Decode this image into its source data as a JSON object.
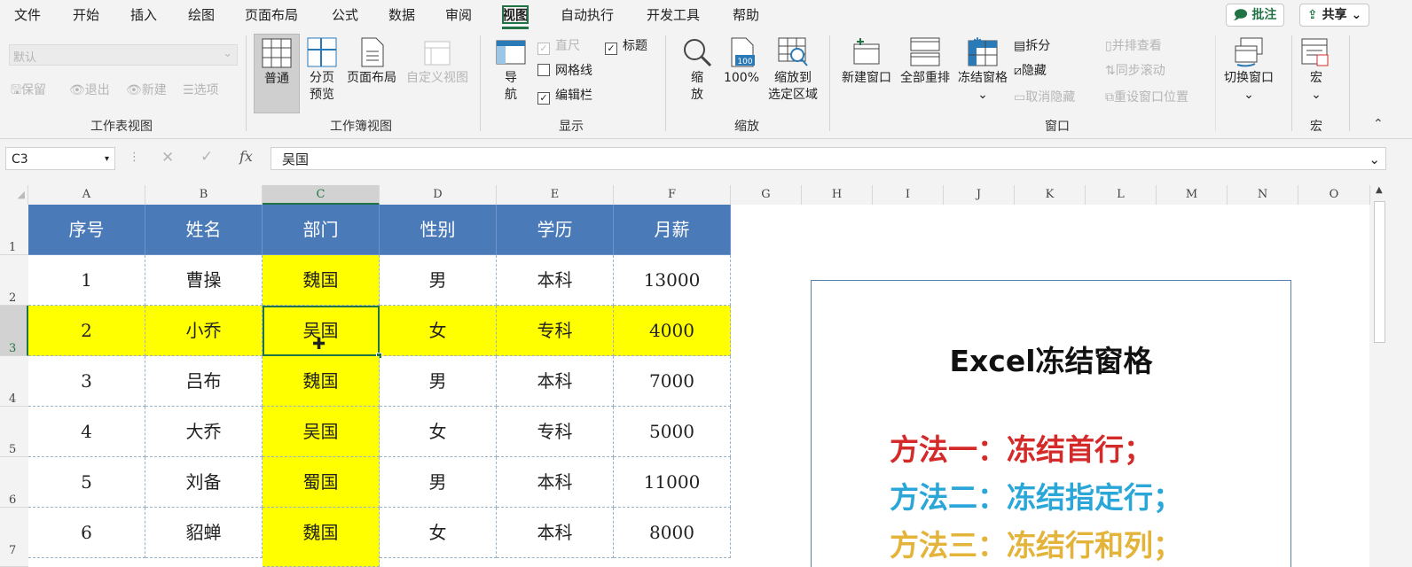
{
  "menu": [
    "文件",
    "开始",
    "插入",
    "绘图",
    "页面布局",
    "公式",
    "数据",
    "审阅",
    "视图",
    "自动执行",
    "开发工具",
    "帮助"
  ],
  "active_menu": "视图",
  "top_buttons": {
    "comments": "批注",
    "share": "共享"
  },
  "ribbon": {
    "sheet_view": {
      "dropdown_value": "默认",
      "keep": "保留",
      "exit": "退出",
      "new": "新建",
      "options": "选项",
      "label": "工作表视图"
    },
    "workbook_views": {
      "normal": "普通",
      "page_break_1": "分页",
      "page_break_2": "预览",
      "page_layout": "页面布局",
      "custom": "自定义视图",
      "label": "工作簿视图"
    },
    "show": {
      "nav_1": "导",
      "nav_2": "航",
      "ruler": "直尺",
      "gridlines": "网格线",
      "formula_bar": "编辑栏",
      "headings": "标题",
      "label": "显示"
    },
    "zoom": {
      "zoom_1": "缩",
      "zoom_2": "放",
      "hundred": "100%",
      "zoom_sel_1": "缩放到",
      "zoom_sel_2": "选定区域",
      "label": "缩放"
    },
    "window": {
      "new_window": "新建窗口",
      "arrange_all": "全部重排",
      "freeze": "冻结窗格",
      "split": "拆分",
      "hide": "隐藏",
      "unhide": "取消隐藏",
      "side_by_side": "并排查看",
      "sync_scroll": "同步滚动",
      "reset_pos": "重设窗口位置",
      "switch": "切换窗口",
      "label": "窗口"
    },
    "macros": {
      "macro": "宏",
      "label": "宏"
    }
  },
  "formula_bar": {
    "name_box": "C3",
    "fx": "fx",
    "content": "吴国"
  },
  "columns": [
    "A",
    "B",
    "C",
    "D",
    "E",
    "F",
    "G",
    "H",
    "I",
    "J",
    "K",
    "L",
    "M",
    "N",
    "O"
  ],
  "rows": [
    "1",
    "2",
    "3",
    "4",
    "5",
    "6",
    "7"
  ],
  "table": {
    "headers": [
      "序号",
      "姓名",
      "部门",
      "性别",
      "学历",
      "月薪"
    ],
    "rows": [
      [
        "1",
        "曹操",
        "魏国",
        "男",
        "本科",
        "13000"
      ],
      [
        "2",
        "小乔",
        "吴国",
        "女",
        "专科",
        "4000"
      ],
      [
        "3",
        "吕布",
        "魏国",
        "男",
        "本科",
        "7000"
      ],
      [
        "4",
        "大乔",
        "吴国",
        "女",
        "专科",
        "5000"
      ],
      [
        "5",
        "刘备",
        "蜀国",
        "男",
        "本科",
        "11000"
      ],
      [
        "6",
        "貂蝉",
        "魏国",
        "女",
        "本科",
        "8000"
      ]
    ]
  },
  "card": {
    "title": "Excel冻结窗格",
    "methods": [
      {
        "text": "方法一：冻结首行；",
        "color": "#d42a2a"
      },
      {
        "text": "方法二：冻结指定行；",
        "color": "#2aa7d8"
      },
      {
        "text": "方法三：冻结行和列；",
        "color": "#e3b33a"
      }
    ]
  },
  "colors": {
    "accent": "#217346",
    "header_fill": "#4a7ab8",
    "highlight": "#ffff00"
  }
}
